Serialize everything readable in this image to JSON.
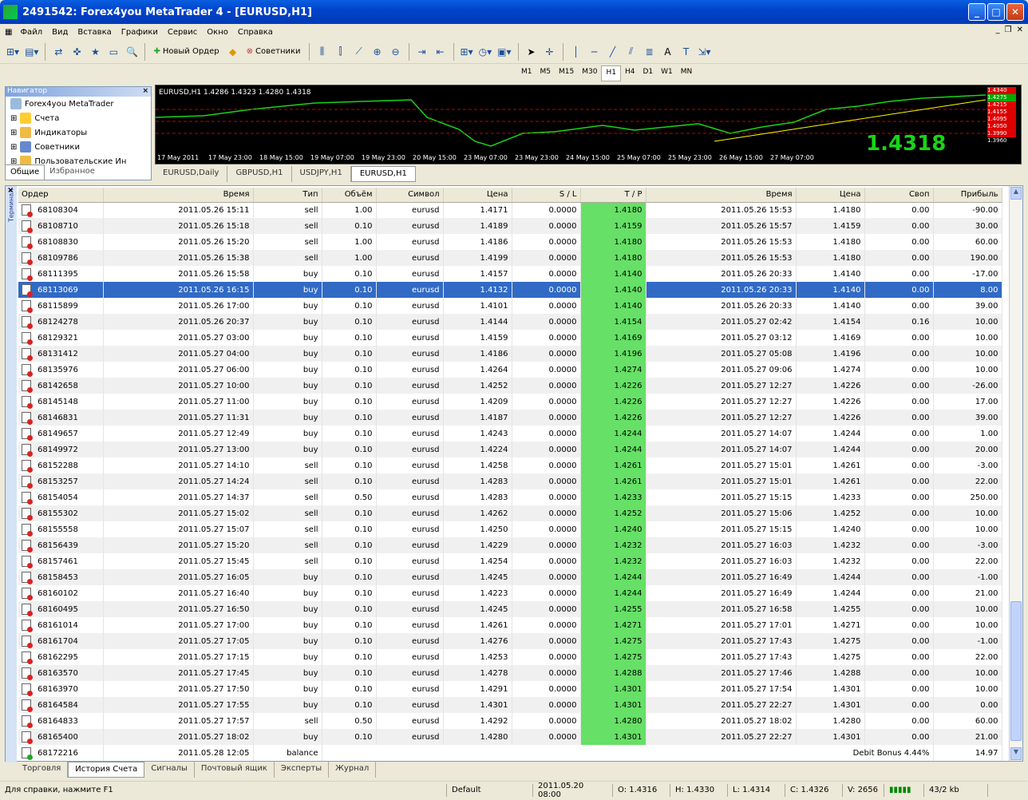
{
  "window": {
    "title": "2491542: Forex4you MetaTrader 4 - [EURUSD,H1]"
  },
  "menu": [
    "Файл",
    "Вид",
    "Вставка",
    "Графики",
    "Сервис",
    "Окно",
    "Справка"
  ],
  "toolbar": {
    "new_order": "Новый Ордер",
    "experts": "Советники"
  },
  "timeframes": [
    "M1",
    "M5",
    "M15",
    "M30",
    "H1",
    "H4",
    "D1",
    "W1",
    "MN"
  ],
  "navigator": {
    "title": "Навигатор",
    "items": [
      "Forex4you MetaTrader",
      "Счета",
      "Индикаторы",
      "Советники",
      "Пользовательские Ин"
    ],
    "tabs": [
      "Общие",
      "Избранное"
    ]
  },
  "chart": {
    "info": "EURUSD,H1  1.4286 1.4323 1.4280 1.4318",
    "axis": [
      "17 May 2011",
      "17 May 23:00",
      "18 May 15:00",
      "19 May 07:00",
      "19 May 23:00",
      "20 May 15:00",
      "23 May 07:00",
      "23 May 23:00",
      "24 May 15:00",
      "25 May 07:00",
      "25 May 23:00",
      "26 May 15:00",
      "27 May 07:00"
    ],
    "prices": [
      "1.4340",
      "1.4275",
      "1.4215",
      "1.4155",
      "1.4095",
      "1.4050",
      "1.3990",
      "1.3960"
    ],
    "big_price": "1.4318"
  },
  "chart_tabs": [
    "EURUSD,Daily",
    "GBPUSD,H1",
    "USDJPY,H1",
    "EURUSD,H1"
  ],
  "table": {
    "headers": [
      "Ордер",
      "Время",
      "Тип",
      "Объём",
      "Символ",
      "Цена",
      "S / L",
      "T / P",
      "Время",
      "Цена",
      "Своп",
      "Прибыль"
    ],
    "rows": [
      [
        "68108304",
        "2011.05.26 15:11",
        "sell",
        "1.00",
        "eurusd",
        "1.4171",
        "0.0000",
        "1.4180",
        "2011.05.26 15:53",
        "1.4180",
        "0.00",
        "-90.00"
      ],
      [
        "68108710",
        "2011.05.26 15:18",
        "sell",
        "0.10",
        "eurusd",
        "1.4189",
        "0.0000",
        "1.4159",
        "2011.05.26 15:57",
        "1.4159",
        "0.00",
        "30.00"
      ],
      [
        "68108830",
        "2011.05.26 15:20",
        "sell",
        "1.00",
        "eurusd",
        "1.4186",
        "0.0000",
        "1.4180",
        "2011.05.26 15:53",
        "1.4180",
        "0.00",
        "60.00"
      ],
      [
        "68109786",
        "2011.05.26 15:38",
        "sell",
        "1.00",
        "eurusd",
        "1.4199",
        "0.0000",
        "1.4180",
        "2011.05.26 15:53",
        "1.4180",
        "0.00",
        "190.00"
      ],
      [
        "68111395",
        "2011.05.26 15:58",
        "buy",
        "0.10",
        "eurusd",
        "1.4157",
        "0.0000",
        "1.4140",
        "2011.05.26 20:33",
        "1.4140",
        "0.00",
        "-17.00"
      ],
      [
        "68113069",
        "2011.05.26 16:15",
        "buy",
        "0.10",
        "eurusd",
        "1.4132",
        "0.0000",
        "1.4140",
        "2011.05.26 20:33",
        "1.4140",
        "0.00",
        "8.00"
      ],
      [
        "68115899",
        "2011.05.26 17:00",
        "buy",
        "0.10",
        "eurusd",
        "1.4101",
        "0.0000",
        "1.4140",
        "2011.05.26 20:33",
        "1.4140",
        "0.00",
        "39.00"
      ],
      [
        "68124278",
        "2011.05.26 20:37",
        "buy",
        "0.10",
        "eurusd",
        "1.4144",
        "0.0000",
        "1.4154",
        "2011.05.27 02:42",
        "1.4154",
        "0.16",
        "10.00"
      ],
      [
        "68129321",
        "2011.05.27 03:00",
        "buy",
        "0.10",
        "eurusd",
        "1.4159",
        "0.0000",
        "1.4169",
        "2011.05.27 03:12",
        "1.4169",
        "0.00",
        "10.00"
      ],
      [
        "68131412",
        "2011.05.27 04:00",
        "buy",
        "0.10",
        "eurusd",
        "1.4186",
        "0.0000",
        "1.4196",
        "2011.05.27 05:08",
        "1.4196",
        "0.00",
        "10.00"
      ],
      [
        "68135976",
        "2011.05.27 06:00",
        "buy",
        "0.10",
        "eurusd",
        "1.4264",
        "0.0000",
        "1.4274",
        "2011.05.27 09:06",
        "1.4274",
        "0.00",
        "10.00"
      ],
      [
        "68142658",
        "2011.05.27 10:00",
        "buy",
        "0.10",
        "eurusd",
        "1.4252",
        "0.0000",
        "1.4226",
        "2011.05.27 12:27",
        "1.4226",
        "0.00",
        "-26.00"
      ],
      [
        "68145148",
        "2011.05.27 11:00",
        "buy",
        "0.10",
        "eurusd",
        "1.4209",
        "0.0000",
        "1.4226",
        "2011.05.27 12:27",
        "1.4226",
        "0.00",
        "17.00"
      ],
      [
        "68146831",
        "2011.05.27 11:31",
        "buy",
        "0.10",
        "eurusd",
        "1.4187",
        "0.0000",
        "1.4226",
        "2011.05.27 12:27",
        "1.4226",
        "0.00",
        "39.00"
      ],
      [
        "68149657",
        "2011.05.27 12:49",
        "buy",
        "0.10",
        "eurusd",
        "1.4243",
        "0.0000",
        "1.4244",
        "2011.05.27 14:07",
        "1.4244",
        "0.00",
        "1.00"
      ],
      [
        "68149972",
        "2011.05.27 13:00",
        "buy",
        "0.10",
        "eurusd",
        "1.4224",
        "0.0000",
        "1.4244",
        "2011.05.27 14:07",
        "1.4244",
        "0.00",
        "20.00"
      ],
      [
        "68152288",
        "2011.05.27 14:10",
        "sell",
        "0.10",
        "eurusd",
        "1.4258",
        "0.0000",
        "1.4261",
        "2011.05.27 15:01",
        "1.4261",
        "0.00",
        "-3.00"
      ],
      [
        "68153257",
        "2011.05.27 14:24",
        "sell",
        "0.10",
        "eurusd",
        "1.4283",
        "0.0000",
        "1.4261",
        "2011.05.27 15:01",
        "1.4261",
        "0.00",
        "22.00"
      ],
      [
        "68154054",
        "2011.05.27 14:37",
        "sell",
        "0.50",
        "eurusd",
        "1.4283",
        "0.0000",
        "1.4233",
        "2011.05.27 15:15",
        "1.4233",
        "0.00",
        "250.00"
      ],
      [
        "68155302",
        "2011.05.27 15:02",
        "sell",
        "0.10",
        "eurusd",
        "1.4262",
        "0.0000",
        "1.4252",
        "2011.05.27 15:06",
        "1.4252",
        "0.00",
        "10.00"
      ],
      [
        "68155558",
        "2011.05.27 15:07",
        "sell",
        "0.10",
        "eurusd",
        "1.4250",
        "0.0000",
        "1.4240",
        "2011.05.27 15:15",
        "1.4240",
        "0.00",
        "10.00"
      ],
      [
        "68156439",
        "2011.05.27 15:20",
        "sell",
        "0.10",
        "eurusd",
        "1.4229",
        "0.0000",
        "1.4232",
        "2011.05.27 16:03",
        "1.4232",
        "0.00",
        "-3.00"
      ],
      [
        "68157461",
        "2011.05.27 15:45",
        "sell",
        "0.10",
        "eurusd",
        "1.4254",
        "0.0000",
        "1.4232",
        "2011.05.27 16:03",
        "1.4232",
        "0.00",
        "22.00"
      ],
      [
        "68158453",
        "2011.05.27 16:05",
        "buy",
        "0.10",
        "eurusd",
        "1.4245",
        "0.0000",
        "1.4244",
        "2011.05.27 16:49",
        "1.4244",
        "0.00",
        "-1.00"
      ],
      [
        "68160102",
        "2011.05.27 16:40",
        "buy",
        "0.10",
        "eurusd",
        "1.4223",
        "0.0000",
        "1.4244",
        "2011.05.27 16:49",
        "1.4244",
        "0.00",
        "21.00"
      ],
      [
        "68160495",
        "2011.05.27 16:50",
        "buy",
        "0.10",
        "eurusd",
        "1.4245",
        "0.0000",
        "1.4255",
        "2011.05.27 16:58",
        "1.4255",
        "0.00",
        "10.00"
      ],
      [
        "68161014",
        "2011.05.27 17:00",
        "buy",
        "0.10",
        "eurusd",
        "1.4261",
        "0.0000",
        "1.4271",
        "2011.05.27 17:01",
        "1.4271",
        "0.00",
        "10.00"
      ],
      [
        "68161704",
        "2011.05.27 17:05",
        "buy",
        "0.10",
        "eurusd",
        "1.4276",
        "0.0000",
        "1.4275",
        "2011.05.27 17:43",
        "1.4275",
        "0.00",
        "-1.00"
      ],
      [
        "68162295",
        "2011.05.27 17:15",
        "buy",
        "0.10",
        "eurusd",
        "1.4253",
        "0.0000",
        "1.4275",
        "2011.05.27 17:43",
        "1.4275",
        "0.00",
        "22.00"
      ],
      [
        "68163570",
        "2011.05.27 17:45",
        "buy",
        "0.10",
        "eurusd",
        "1.4278",
        "0.0000",
        "1.4288",
        "2011.05.27 17:46",
        "1.4288",
        "0.00",
        "10.00"
      ],
      [
        "68163970",
        "2011.05.27 17:50",
        "buy",
        "0.10",
        "eurusd",
        "1.4291",
        "0.0000",
        "1.4301",
        "2011.05.27 17:54",
        "1.4301",
        "0.00",
        "10.00"
      ],
      [
        "68164584",
        "2011.05.27 17:55",
        "buy",
        "0.10",
        "eurusd",
        "1.4301",
        "0.0000",
        "1.4301",
        "2011.05.27 22:27",
        "1.4301",
        "0.00",
        "0.00"
      ],
      [
        "68164833",
        "2011.05.27 17:57",
        "sell",
        "0.50",
        "eurusd",
        "1.4292",
        "0.0000",
        "1.4280",
        "2011.05.27 18:02",
        "1.4280",
        "0.00",
        "60.00"
      ],
      [
        "68165400",
        "2011.05.27 18:02",
        "buy",
        "0.10",
        "eurusd",
        "1.4280",
        "0.0000",
        "1.4301",
        "2011.05.27 22:27",
        "1.4301",
        "0.00",
        "21.00"
      ]
    ],
    "balance": {
      "order": "68172216",
      "time": "2011.05.28 12:05",
      "type": "balance",
      "comment": "Debit Bonus 4.44%",
      "profit": "14.97"
    }
  },
  "terminal_label": "Терминал",
  "terminal_tabs": [
    "Торговля",
    "История Счета",
    "Сигналы",
    "Почтовый ящик",
    "Эксперты",
    "Журнал"
  ],
  "status": {
    "help": "Для справки, нажмите F1",
    "profile": "Default",
    "time": "2011.05.20 08:00",
    "open": "O: 1.4316",
    "high": "H: 1.4330",
    "low": "L: 1.4314",
    "close": "C: 1.4326",
    "volume": "V: 2656",
    "traffic": "43/2 kb"
  }
}
